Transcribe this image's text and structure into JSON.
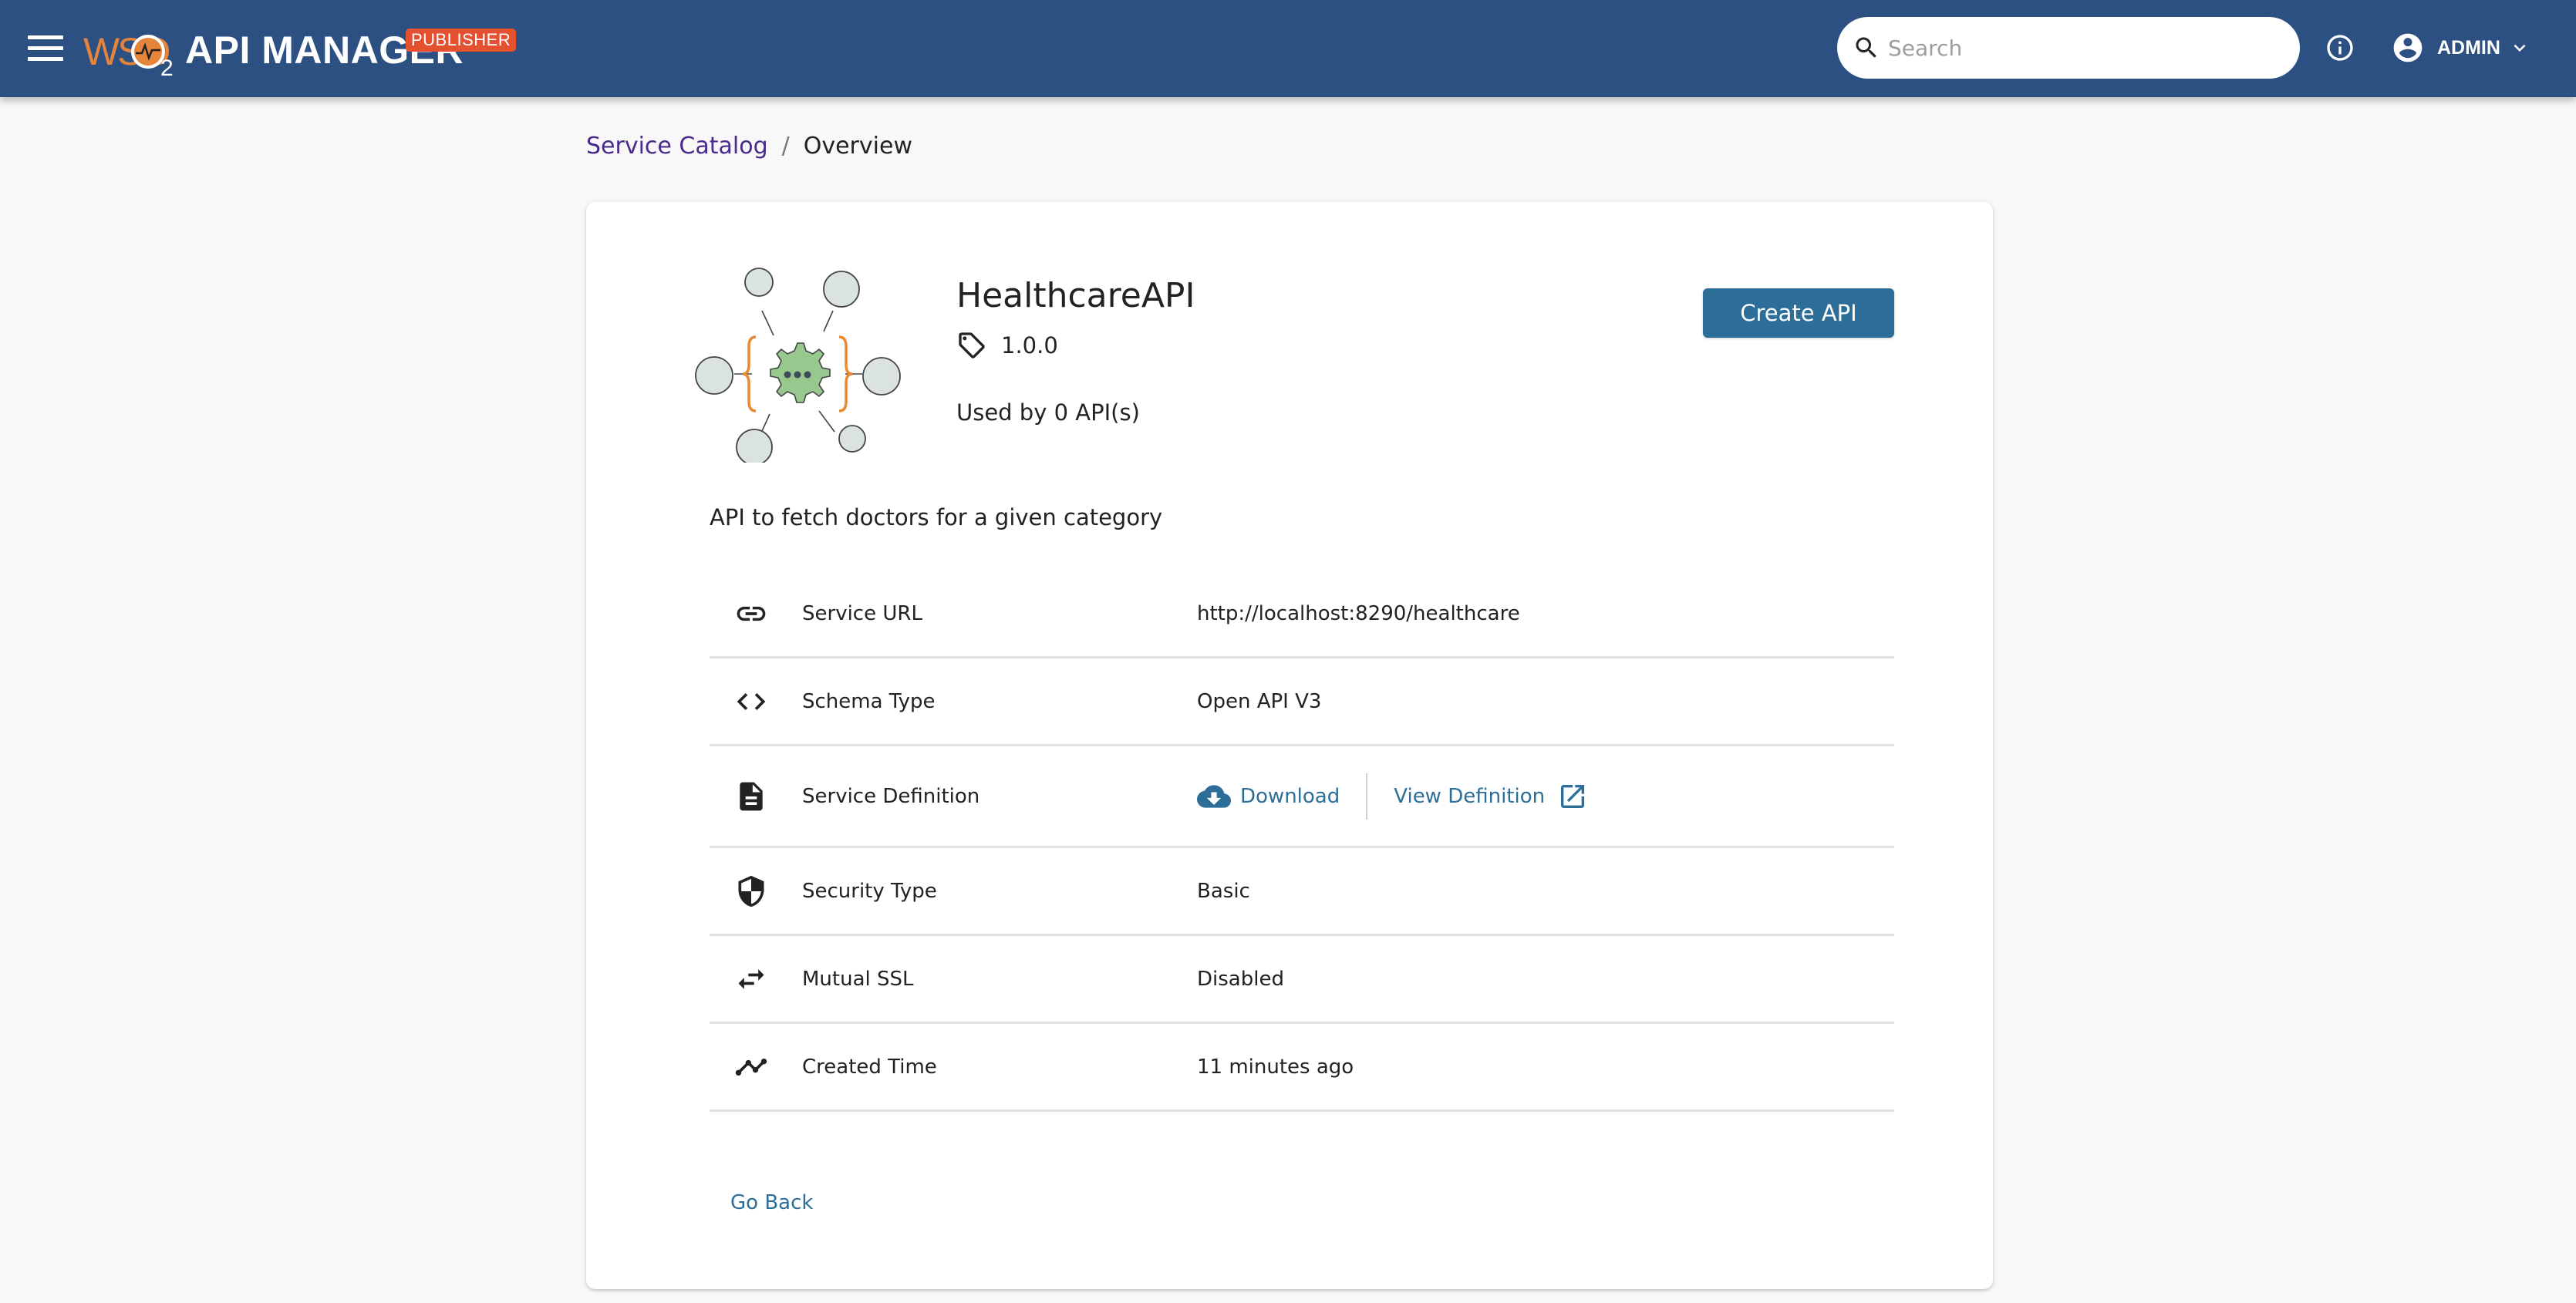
{
  "header": {
    "logo_brand": "WSO",
    "logo_sub": "2",
    "product_name": "API MANAGER",
    "badge": "PUBLISHER",
    "search_placeholder": "Search",
    "user_name": "ADMIN",
    "colors": {
      "appbar": "#2d5083",
      "badge": "#e5512f",
      "brand_orange": "#e5843b"
    }
  },
  "breadcrumb": {
    "items": [
      {
        "label": "Service Catalog"
      },
      {
        "label": "Overview"
      }
    ],
    "separator": "/"
  },
  "service": {
    "name": "HealthcareAPI",
    "version": "1.0.0",
    "used_by": "Used by 0 API(s)",
    "description": "API to fetch doctors for a given category",
    "create_api_label": "Create API"
  },
  "properties": [
    {
      "icon": "link-icon",
      "label": "Service URL",
      "value": "http://localhost:8290/healthcare"
    },
    {
      "icon": "code-icon",
      "label": "Schema Type",
      "value": "Open API V3"
    },
    {
      "icon": "document-icon",
      "label": "Service Definition",
      "download_label": "Download",
      "view_label": "View Definition"
    },
    {
      "icon": "shield-icon",
      "label": "Security Type",
      "value": "Basic"
    },
    {
      "icon": "swap-arrows-icon",
      "label": "Mutual SSL",
      "value": "Disabled"
    },
    {
      "icon": "timeline-icon",
      "label": "Created Time",
      "value": "11 minutes ago"
    }
  ],
  "actions": {
    "go_back_label": "Go Back"
  },
  "theme": {
    "primary": "#2d6e98",
    "breadcrumb_link": "#4a2a8a"
  }
}
